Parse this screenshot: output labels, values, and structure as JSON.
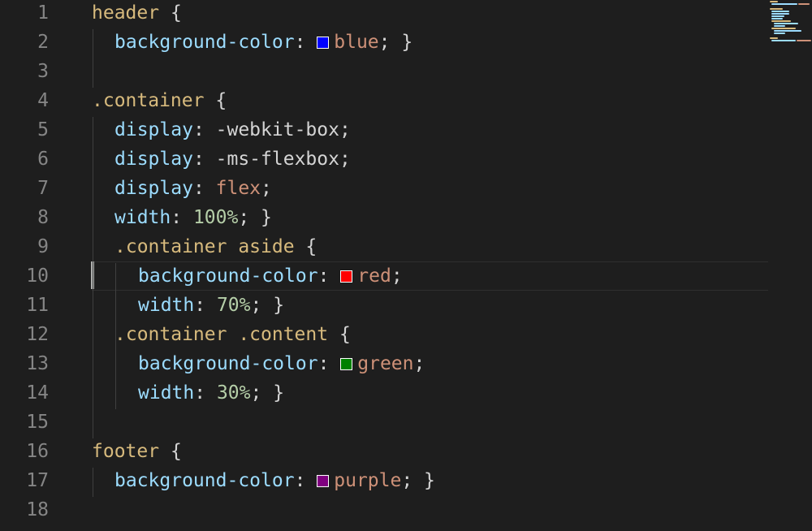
{
  "editor": {
    "colors": {
      "background": "#1e1e1e",
      "line_number": "#858585",
      "selector": "#d7ba7d",
      "property": "#9cdcfe",
      "value": "#ce9178",
      "number": "#b5cea8",
      "punctuation": "#d4d4d4"
    },
    "line_numbers": [
      "1",
      "2",
      "3",
      "4",
      "5",
      "6",
      "7",
      "8",
      "9",
      "10",
      "11",
      "12",
      "13",
      "14",
      "15",
      "16",
      "17",
      "18"
    ],
    "current_line": "10",
    "code": {
      "l1": {
        "selector": "header",
        "brace": " {"
      },
      "l2": {
        "prop": "background-color",
        "colon": ": ",
        "swatch": "#0000ff",
        "value": "blue",
        "end": "; }"
      },
      "l4": {
        "selector": ".container",
        "brace": " {"
      },
      "l5": {
        "prop": "display",
        "colon": ": ",
        "value": "-webkit-box",
        "end": ";"
      },
      "l6": {
        "prop": "display",
        "colon": ": ",
        "value": "-ms-flexbox",
        "end": ";"
      },
      "l7": {
        "prop": "display",
        "colon": ": ",
        "value": "flex",
        "end": ";"
      },
      "l8": {
        "prop": "width",
        "colon": ": ",
        "value": "100%",
        "end": "; }"
      },
      "l9": {
        "selector": ".container aside",
        "brace": " {"
      },
      "l10": {
        "prop": "background-color",
        "colon": ": ",
        "swatch": "#ff0000",
        "value": "red",
        "end": ";"
      },
      "l11": {
        "prop": "width",
        "colon": ": ",
        "value": "70%",
        "end": "; }"
      },
      "l12": {
        "selector": ".container .content",
        "brace": " {"
      },
      "l13": {
        "prop": "background-color",
        "colon": ": ",
        "swatch": "#008000",
        "value": "green",
        "end": ";"
      },
      "l14": {
        "prop": "width",
        "colon": ": ",
        "value": "30%",
        "end": "; }"
      },
      "l16": {
        "selector": "footer",
        "brace": " {"
      },
      "l17": {
        "prop": "background-color",
        "colon": ": ",
        "swatch": "#800080",
        "value": "purple",
        "end": "; }"
      }
    }
  }
}
